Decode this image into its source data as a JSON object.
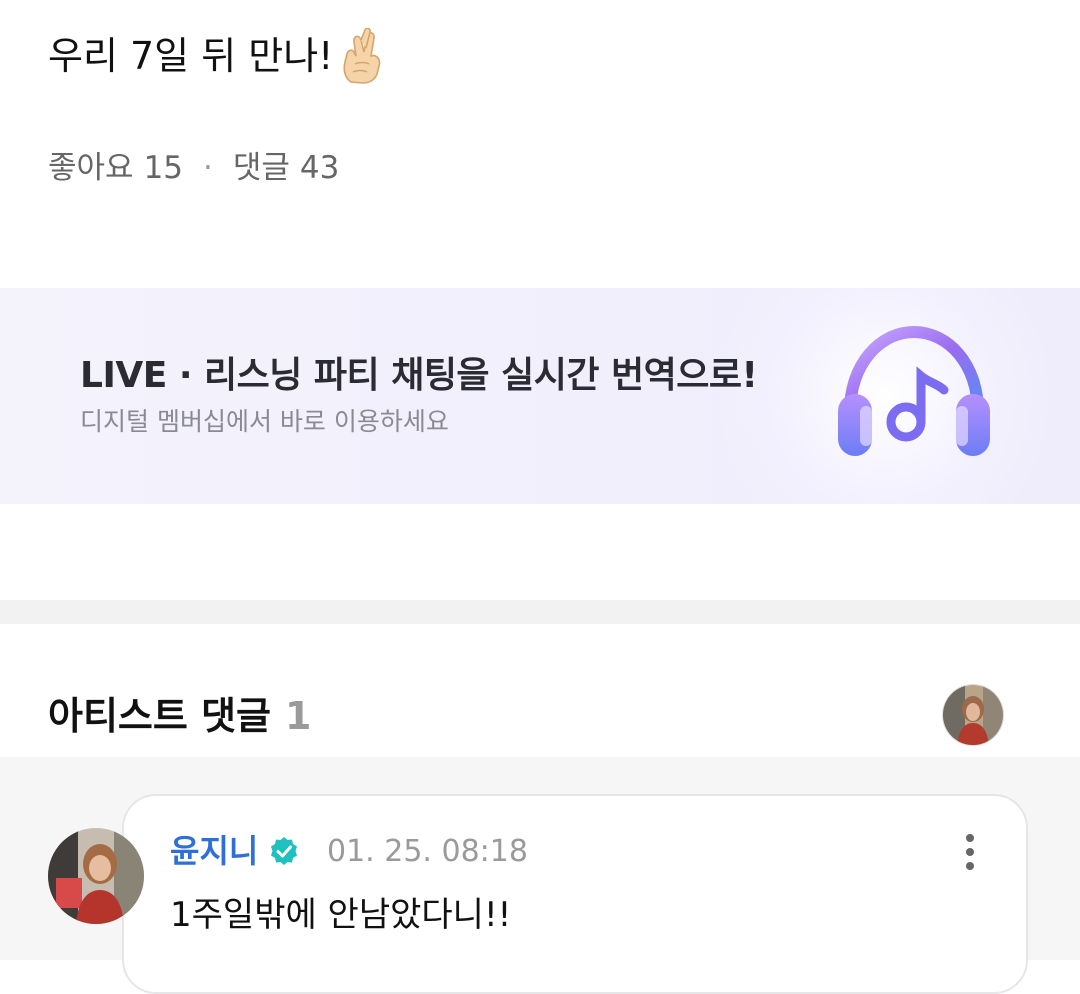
{
  "post": {
    "text": "우리 7일 뒤 만나!",
    "emoji_icon": "crossed-fingers-emoji"
  },
  "stats": {
    "likes_label": "좋아요",
    "likes_count": "15",
    "separator": "·",
    "comments_label": "댓글",
    "comments_count": "43"
  },
  "banner": {
    "title": "LIVE · 리스닝 파티 채팅을 실시간 번역으로!",
    "subtitle": "디지털 멤버십에서 바로 이용하세요",
    "icon": "headphones-music-icon"
  },
  "artist_comments": {
    "heading": "아티스트 댓글",
    "count": "1"
  },
  "comment": {
    "author": "윤지니",
    "verified_icon": "verified-badge-icon",
    "timestamp": "01. 25. 08:18",
    "text": "1주일밖에 안남았다니!!",
    "more_icon": "more-vertical-icon"
  },
  "colors": {
    "author_blue": "#2e6fd8",
    "verified_teal": "#1fc0c0",
    "banner_bg": "#f1effc",
    "headphone_purple": "#9b6cf0",
    "headphone_blue": "#5a8cf5"
  }
}
